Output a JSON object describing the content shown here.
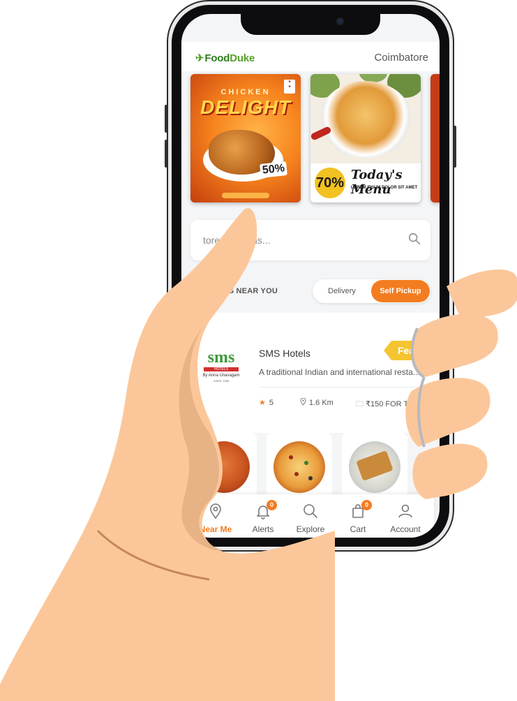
{
  "header": {
    "logo_food": "Food",
    "logo_duke": "Duke",
    "city": "Coimbatore"
  },
  "banners": [
    {
      "line1": "CHICKEN",
      "line2": "DELIGHT",
      "badge": "50%"
    },
    {
      "discount": "70%",
      "title": "Today's Menu",
      "subtitle": "LOREM IPSUM DOLOR SIT AMET"
    }
  ],
  "search": {
    "placeholder": "tores or items..."
  },
  "nearby": {
    "label": "TAURANTS NEAR YOU",
    "toggle": {
      "option_1": "Delivery",
      "option_2": "Self Pickup",
      "selected": "Self Pickup"
    }
  },
  "restaurant": {
    "logo_text": "sms",
    "logo_bar": "HOTELS",
    "logo_tagline": "By Anna Unavagam",
    "logo_since": "SINCE 1968",
    "name": "SMS Hotels",
    "badge": "Featured",
    "description": "A traditional Indian and international resta...",
    "rating": "5",
    "distance": "1.6 Km",
    "price": "₹150 FOR TWO"
  },
  "bottom_nav": [
    {
      "label": "Near Me",
      "icon": "location-pin-icon",
      "active": true
    },
    {
      "label": "Alerts",
      "icon": "bell-icon",
      "badge": "0"
    },
    {
      "label": "Explore",
      "icon": "search-icon"
    },
    {
      "label": "Cart",
      "icon": "shopping-bag-icon",
      "badge": "0"
    },
    {
      "label": "Account",
      "icon": "user-icon"
    }
  ],
  "colors": {
    "accent": "#f47c20",
    "brand_green": "#2f7d1f",
    "featured": "#f5c431",
    "skin": "#fbc79a"
  }
}
